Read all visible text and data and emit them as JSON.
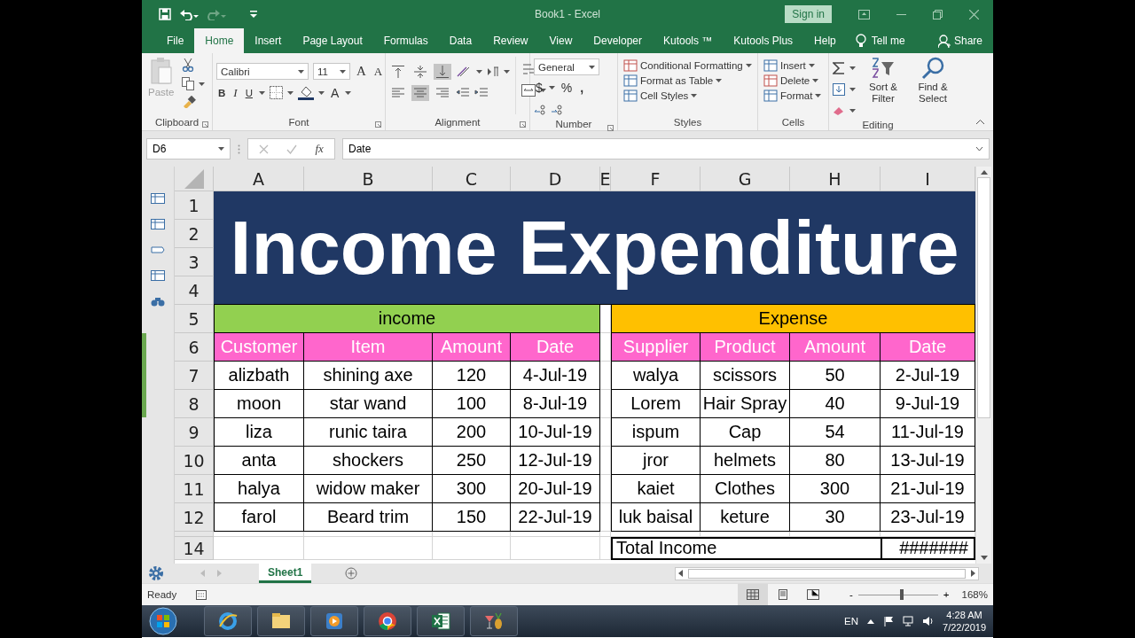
{
  "window": {
    "title": "Book1  -  Excel",
    "sign_in": "Sign in"
  },
  "menu_tabs": [
    {
      "label": "File",
      "selected": false
    },
    {
      "label": "Home",
      "selected": true
    },
    {
      "label": "Insert",
      "selected": false
    },
    {
      "label": "Page Layout",
      "selected": false
    },
    {
      "label": "Formulas",
      "selected": false
    },
    {
      "label": "Data",
      "selected": false
    },
    {
      "label": "Review",
      "selected": false
    },
    {
      "label": "View",
      "selected": false
    },
    {
      "label": "Developer",
      "selected": false
    },
    {
      "label": "Kutools ™",
      "selected": false
    },
    {
      "label": "Kutools Plus",
      "selected": false
    },
    {
      "label": "Help",
      "selected": false
    }
  ],
  "tell_me": "Tell me",
  "share": "Share",
  "ribbon": {
    "clipboard": {
      "label": "Clipboard",
      "paste": "Paste",
      "paste_disabled": true
    },
    "font": {
      "label": "Font",
      "font_name": "Calibri",
      "font_size": "11",
      "grow": "A",
      "shrink": "A",
      "bold": "B",
      "italic": "I",
      "underline": "U",
      "font_color": "A"
    },
    "alignment": {
      "label": "Alignment",
      "buttons": [
        {
          "kind": "top",
          "selected": false
        },
        {
          "kind": "middle",
          "selected": false
        },
        {
          "kind": "bottom",
          "selected": true
        },
        {
          "kind": "left",
          "selected": false
        },
        {
          "kind": "center",
          "selected": true
        },
        {
          "kind": "right",
          "selected": false
        }
      ]
    },
    "number": {
      "label": "Number",
      "format": "General",
      "currency": "$",
      "percent": "%",
      "comma": ","
    },
    "styles": {
      "label": "Styles",
      "items": [
        "Conditional Formatting",
        "Format as Table",
        "Cell Styles"
      ]
    },
    "cells": {
      "label": "Cells",
      "items": [
        "Insert",
        "Delete",
        "Format"
      ]
    },
    "editing": {
      "label": "Editing",
      "sort": "Sort & Filter",
      "find": "Find & Select"
    }
  },
  "formula_bar": {
    "name_box": "D6",
    "function_label": "fx",
    "formula": "Date"
  },
  "columns": [
    "A",
    "B",
    "C",
    "D",
    "E",
    "F",
    "G",
    "H",
    "I"
  ],
  "row_numbers": [
    "1",
    "2",
    "3",
    "4",
    "5",
    "6",
    "7",
    "8",
    "9",
    "10",
    "11",
    "12",
    "14"
  ],
  "sheet": {
    "title": "Income Expenditure",
    "income": {
      "heading": "income",
      "columns": [
        "Customer",
        "Item",
        "Amount",
        "Date"
      ],
      "rows": [
        [
          "alizbath",
          "shining axe",
          "120",
          "4-Jul-19"
        ],
        [
          "moon",
          "star wand",
          "100",
          "8-Jul-19"
        ],
        [
          "liza",
          "runic taira",
          "200",
          "10-Jul-19"
        ],
        [
          "anta",
          "shockers",
          "250",
          "12-Jul-19"
        ],
        [
          "halya",
          "widow maker",
          "300",
          "20-Jul-19"
        ],
        [
          "farol",
          "Beard trim",
          "150",
          "22-Jul-19"
        ]
      ]
    },
    "expense": {
      "heading": "Expense",
      "columns": [
        "Supplier",
        "Product",
        "Amount",
        "Date"
      ],
      "rows": [
        [
          "walya",
          "scissors",
          "50",
          "2-Jul-19"
        ],
        [
          "Lorem",
          "Hair Spray",
          "40",
          "9-Jul-19"
        ],
        [
          "ispum",
          "Cap",
          "54",
          "11-Jul-19"
        ],
        [
          "jror",
          "helmets",
          "80",
          "13-Jul-19"
        ],
        [
          "kaiet",
          "Clothes",
          "300",
          "21-Jul-19"
        ],
        [
          "luk baisal",
          "keture",
          "30",
          "23-Jul-19"
        ]
      ]
    },
    "total": {
      "label": "Total Income",
      "value": "#######"
    }
  },
  "sheet_tabs": [
    {
      "label": "Sheet1",
      "selected": true
    }
  ],
  "status_bar": {
    "status": "Ready",
    "views": [
      {
        "kind": "normal",
        "selected": true
      },
      {
        "kind": "layout",
        "selected": false
      },
      {
        "kind": "break",
        "selected": false
      }
    ],
    "zoom_out": "-",
    "zoom_in": "+",
    "zoom": {
      "level": 0.55
    },
    "zoom_text": "168%"
  },
  "taskbar": {
    "language": "EN",
    "time": "4:28 AM",
    "date": "7/22/2019"
  }
}
